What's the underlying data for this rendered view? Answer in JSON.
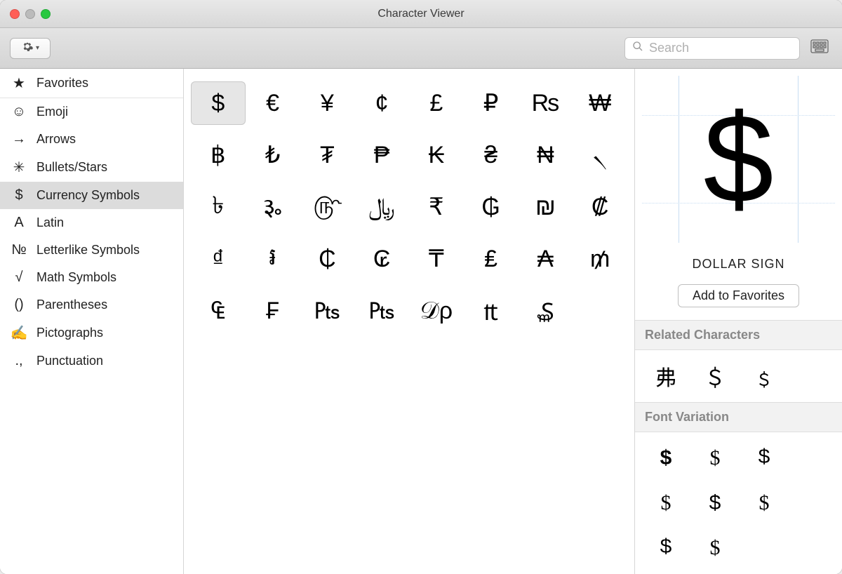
{
  "window": {
    "title": "Character Viewer"
  },
  "search": {
    "placeholder": "Search"
  },
  "sidebar": {
    "items": [
      {
        "icon": "★",
        "label": "Favorites"
      },
      {
        "icon": "☺",
        "label": "Emoji"
      },
      {
        "icon": "→",
        "label": "Arrows"
      },
      {
        "icon": "✳",
        "label": "Bullets/Stars"
      },
      {
        "icon": "$",
        "label": "Currency Symbols"
      },
      {
        "icon": "A",
        "label": "Latin"
      },
      {
        "icon": "№",
        "label": "Letterlike Symbols"
      },
      {
        "icon": "√",
        "label": "Math Symbols"
      },
      {
        "icon": "()",
        "label": "Parentheses"
      },
      {
        "icon": "✍",
        "label": "Pictographs"
      },
      {
        "icon": ".,",
        "label": "Punctuation"
      }
    ],
    "selected_index": 4
  },
  "grid": {
    "chars": [
      "$",
      "€",
      "¥",
      "¢",
      "£",
      "₽",
      "₨",
      "₩",
      "฿",
      "₺",
      "₮",
      "₱",
      "₭",
      "₴",
      "₦",
      "৲",
      "৳",
      "૱",
      "௹",
      "﷼",
      "₹",
      "₲",
      "₪",
      "₡",
      "₫",
      "៛",
      "₵",
      "₢",
      "₸",
      "₤",
      "₳",
      "₥",
      "₠",
      "₣",
      "₧",
      "₧",
      "𝒟ρ",
      "₶",
      "₷",
      "",
      ""
    ],
    "selected_index": 0
  },
  "detail": {
    "char": "$",
    "name": "DOLLAR SIGN",
    "add_label": "Add to Favorites",
    "related_title": "Related Characters",
    "related": [
      "弗",
      "＄",
      "﹩"
    ],
    "variation_title": "Font Variation",
    "variations": [
      "$",
      "$",
      "$",
      "$",
      "$",
      "$",
      "$",
      "$"
    ]
  }
}
